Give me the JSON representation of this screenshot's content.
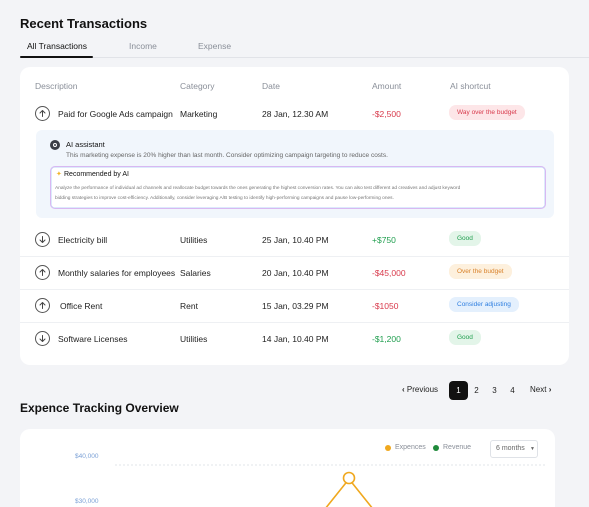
{
  "section_title": "Recent Transactions",
  "tabs": [
    {
      "label": "All Transactions"
    },
    {
      "label": "Income"
    },
    {
      "label": "Expense"
    }
  ],
  "table": {
    "headers": [
      "Description",
      "Category",
      "Date",
      "Amount",
      "AI shortcut"
    ],
    "rows": [
      {
        "direction": "up",
        "description": "Paid for Google Ads campaign",
        "category": "Marketing",
        "date": "28 Jan, 12.30 AM",
        "amount": "-$2,500",
        "badge": "Way over the budget",
        "badge_color": "#d8394b"
      },
      {
        "direction": "down",
        "description": "Electricity bill",
        "category": "Utilities",
        "date": "25 Jan, 10.40 PM",
        "amount": "+$750",
        "badge": "Good",
        "badge_color": "#1f9e4e"
      },
      {
        "direction": "up",
        "description": "Monthly salaries for employees",
        "category": "Salaries",
        "date": "20 Jan, 10.40 PM",
        "amount": "-$45,000",
        "badge": "Over the budget",
        "badge_color": "#d9822b"
      },
      {
        "direction": "up",
        "description": "Office Rent",
        "category": "Rent",
        "date": "15 Jan, 03.29 PM",
        "amount": "-$1050",
        "badge": "Consider adjusting",
        "badge_color": "#2f7fe0"
      },
      {
        "direction": "down",
        "description": "Software Licenses",
        "category": "Utilities",
        "date": "14 Jan, 10.40 PM",
        "amount": "-$1,200",
        "badge": "Good",
        "badge_color": "#1f9e4e"
      }
    ]
  },
  "ai_assistant": {
    "title": "AI assistant",
    "message": "This marketing expense is 20% higher than last month. Consider optimizing campaign targeting to reduce costs.",
    "recommended_title": "Recommended by AI",
    "recommended_text_line1": "Analyze the performance of individual ad channels and reallocate budget towards the ones generating the highest conversion rates. You can also test different ad creatives and adjust keyword",
    "recommended_text_line2": "bidding strategies to improve cost-efficiency. Additionally, consider leveraging A/B testing to identify high-performing campaigns and pause low-performing ones."
  },
  "pagination": {
    "previous": "Previous",
    "pages": [
      "1",
      "2",
      "3",
      "4"
    ],
    "current": "1",
    "next": "Next"
  },
  "overview_title": "Expence Tracking Overview",
  "chart": {
    "legend": [
      {
        "name": "Expences",
        "color": "#f0a81e"
      },
      {
        "name": "Revenue",
        "color": "#1f8a3a"
      }
    ],
    "range_select": "6 months",
    "y_ticks": [
      "$40,000",
      "$30,000"
    ]
  },
  "colors": {
    "negative": "#d8394b",
    "positive": "#1f9e4e",
    "expense_line": "#f0a81e",
    "tick_label": "#7aa0d6"
  }
}
